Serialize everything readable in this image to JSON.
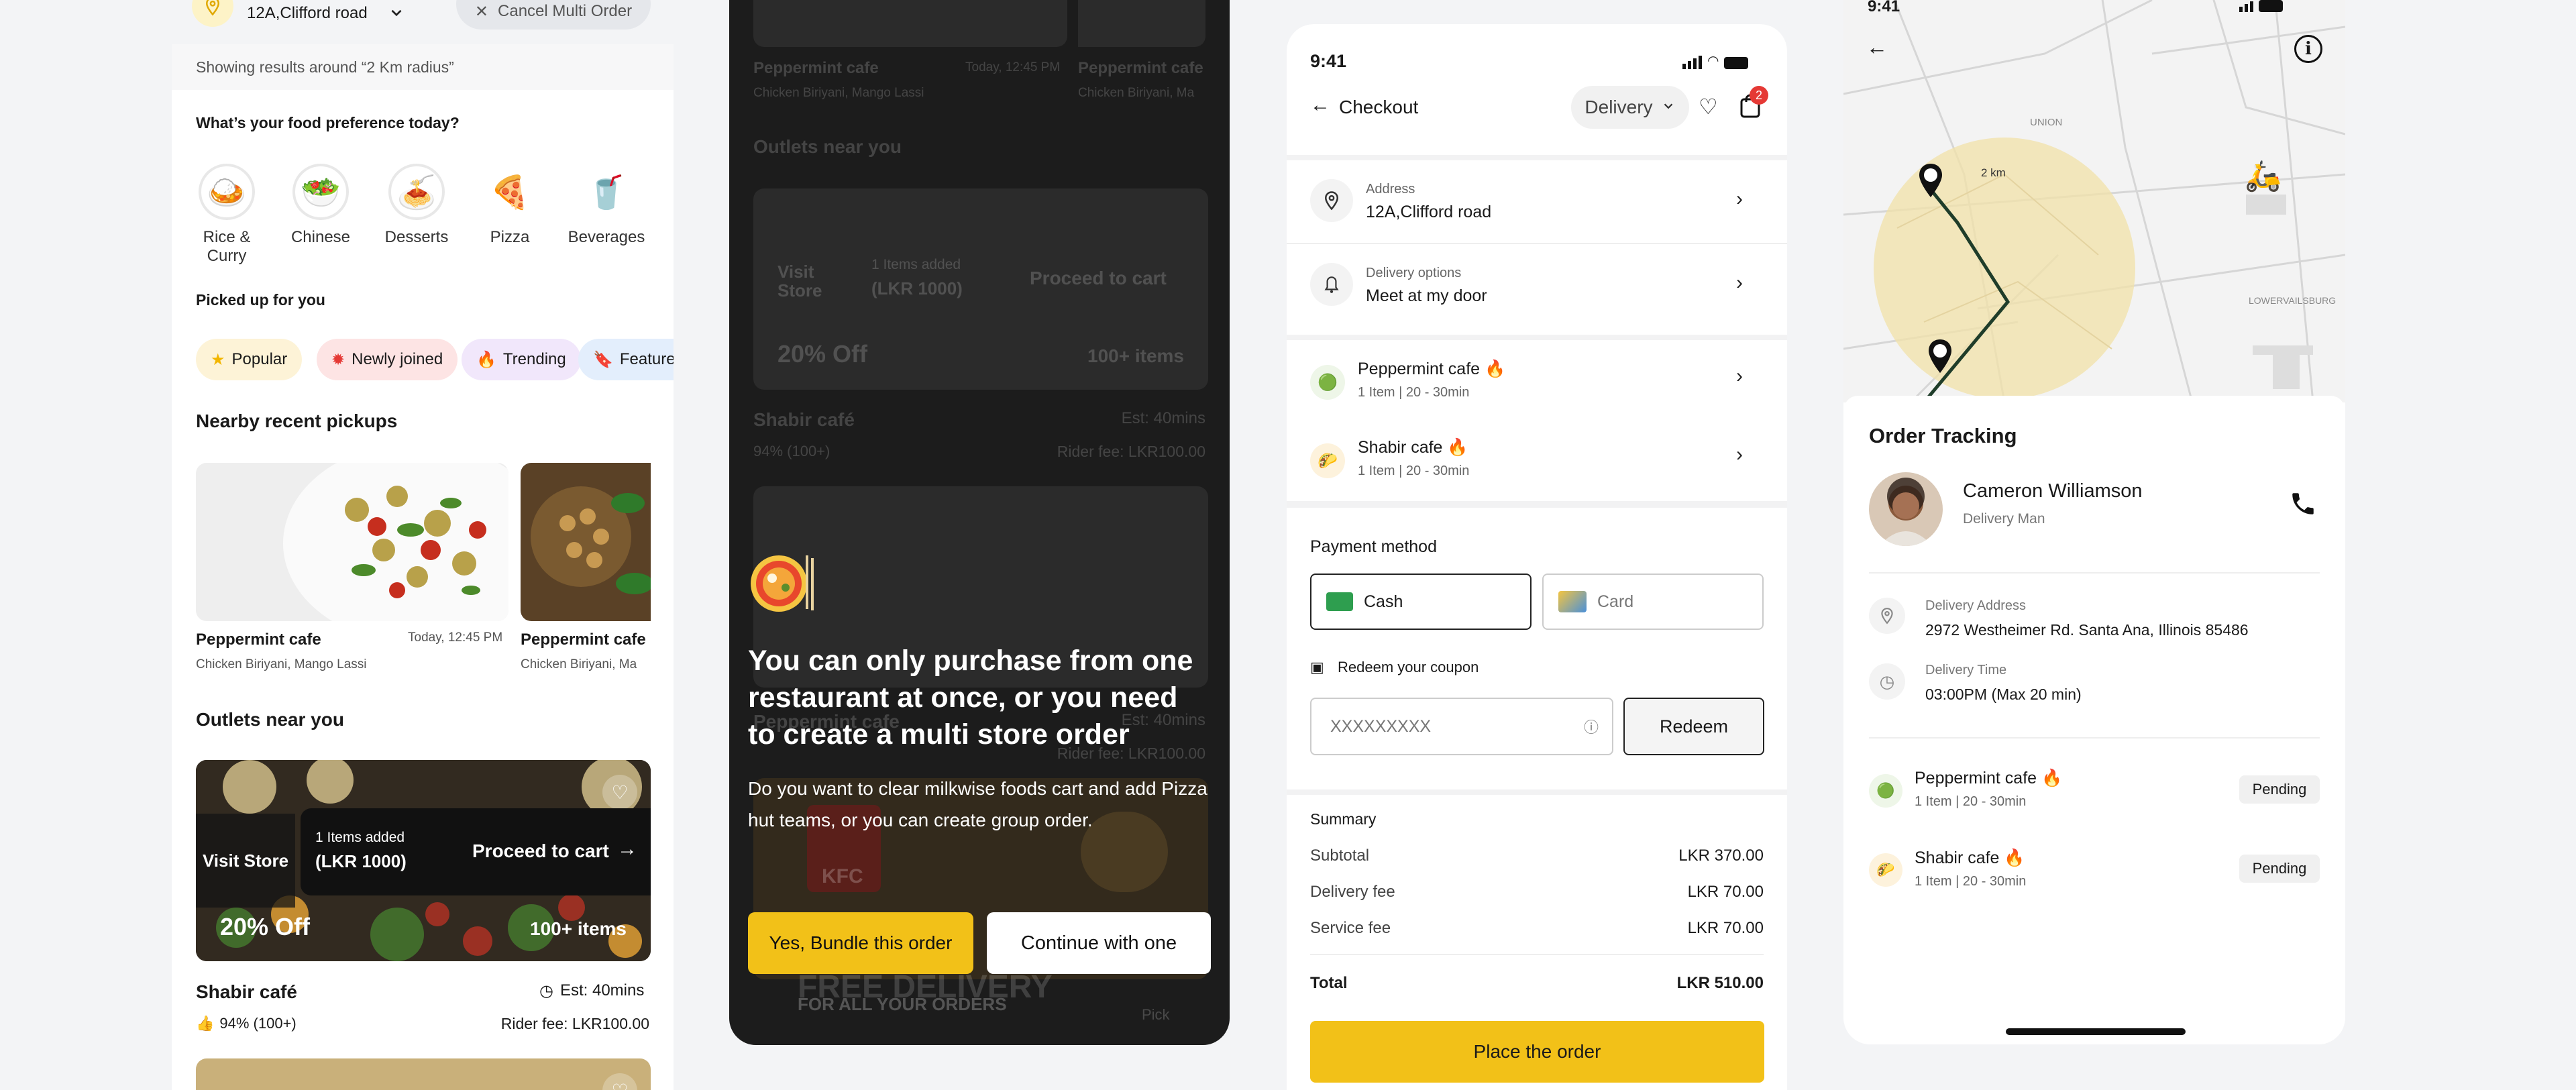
{
  "screen1": {
    "location": "12A,Clifford road",
    "cancel_label": "Cancel Multi Order",
    "results_text": "Showing results around “2 Km radius”",
    "food_pref_title": "What’s your food preference today?",
    "categories": [
      {
        "label": "Rice & Curry",
        "icon": "rice-bowl-icon"
      },
      {
        "label": "Chinese",
        "icon": "noodle-bowl-icon"
      },
      {
        "label": "Desserts",
        "icon": "dessert-icon"
      },
      {
        "label": "Pizza",
        "icon": "pizza-icon"
      },
      {
        "label": "Beverages",
        "icon": "beverage-icon"
      }
    ],
    "picked_title": "Picked up for you",
    "chips": [
      {
        "label": "Popular",
        "icon": "star-icon"
      },
      {
        "label": "Newly joined",
        "icon": "new-badge-icon"
      },
      {
        "label": "Trending",
        "icon": "fire-icon"
      },
      {
        "label": "Feature",
        "icon": "bookmark-icon"
      }
    ],
    "nearby_title": "Nearby recent pickups",
    "pickups": [
      {
        "name": "Peppermint cafe",
        "time": "Today, 12:45 PM",
        "items": "Chicken Biriyani, Mango Lassi"
      },
      {
        "name": "Peppermint cafe",
        "items": "Chicken Biriyani, Ma"
      }
    ],
    "outlets_title": "Outlets near you",
    "outlet": {
      "visit_label": "Visit Store",
      "items_added": "1 Items added",
      "items_price": "(LKR 1000)",
      "proceed_label": "Proceed to cart",
      "discount": "20% Off",
      "item_count": "100+ items",
      "name": "Shabir café",
      "est": "Est: 40mins",
      "rating": "94% (100+)",
      "rider_fee": "Rider fee: LKR100.00"
    }
  },
  "screen2": {
    "bg_pickup_name": "Peppermint cafe",
    "bg_pickup_time": "Today, 12:45 PM",
    "bg_pickup_items": "Chicken Biriyani, Mango Lassi",
    "bg_pickup_name2": "Peppermint cafe",
    "bg_pickup_items2": "Chicken Biriyani, Ma",
    "bg_outlets_title": "Outlets near you",
    "bg_visit": "Visit Store",
    "bg_items_added": "1 Items added",
    "bg_price": "(LKR 1000)",
    "bg_proceed": "Proceed to cart",
    "bg_discount": "20% Off",
    "bg_count": "100+ items",
    "bg_name": "Shabir café",
    "bg_est": "Est: 40mins",
    "bg_rating": "94% (100+)",
    "bg_fee": "Rider fee: LKR100.00",
    "bg_name2": "Peppermint cafe",
    "bg_est2": "Est: 40mins",
    "bg_fee2": "Rider fee: LKR100.00",
    "bg_promo": "FREE DELIVERY",
    "bg_promo_sub": "FOR ALL YOUR ORDERS",
    "bg_brand": "KFC",
    "bg_pick": "Pick",
    "headline": "You can only purchase from one restaurant at once, or you need to create a multi store order",
    "body": "Do you want to clear milkwise foods  cart and add Pizza hut teams, or you can create group order.",
    "primary_btn": "Yes, Bundle this order",
    "secondary_btn": "Continue with one",
    "accent": "#f2c118"
  },
  "screen3": {
    "time": "9:41",
    "title": "Checkout",
    "delivery_mode": "Delivery",
    "cart_count": "2",
    "address_label": "Address",
    "address_value": "12A,Clifford road",
    "delivery_opt_label": "Delivery options",
    "delivery_opt_value": "Meet at my door",
    "stores": [
      {
        "name": "Peppermint cafe 🔥",
        "meta": "1 Item | 20 - 30min"
      },
      {
        "name": "Shabir cafe 🔥",
        "meta": "1 Item | 20 - 30min"
      }
    ],
    "payment_title": "Payment method",
    "pay_cash": "Cash",
    "pay_card": "Card",
    "coupon_title": "Redeem your coupon",
    "coupon_placeholder": "XXXXXXXXX",
    "redeem_btn": "Redeem",
    "summary_title": "Summary",
    "summary": [
      {
        "label": "Subtotal",
        "value": "LKR 370.00"
      },
      {
        "label": "Delivery fee",
        "value": "LKR 70.00"
      },
      {
        "label": "Service fee",
        "value": "LKR 70.00"
      }
    ],
    "total_label": "Total",
    "total_value": "LKR 510.00",
    "place_btn": "Place the order",
    "accent": "#f2c118"
  },
  "screen4": {
    "time": "9:41",
    "map_labels": {
      "distance": "2 km",
      "area1": "UNION",
      "area2": "LOWERVAILSBURG"
    },
    "title": "Order Tracking",
    "courier_name": "Cameron Williamson",
    "courier_role": "Delivery Man",
    "addr_label": "Delivery Address",
    "addr_value": "2972 Westheimer Rd. Santa Ana, Illinois 85486",
    "time_label": "Delivery Time",
    "time_value": "03:00PM (Max 20 min)",
    "stores": [
      {
        "name": "Peppermint cafe 🔥",
        "meta": "1 Item | 20 - 30min",
        "status": "Pending"
      },
      {
        "name": "Shabir cafe 🔥",
        "meta": "1 Item | 20 - 30min",
        "status": "Pending"
      }
    ]
  }
}
